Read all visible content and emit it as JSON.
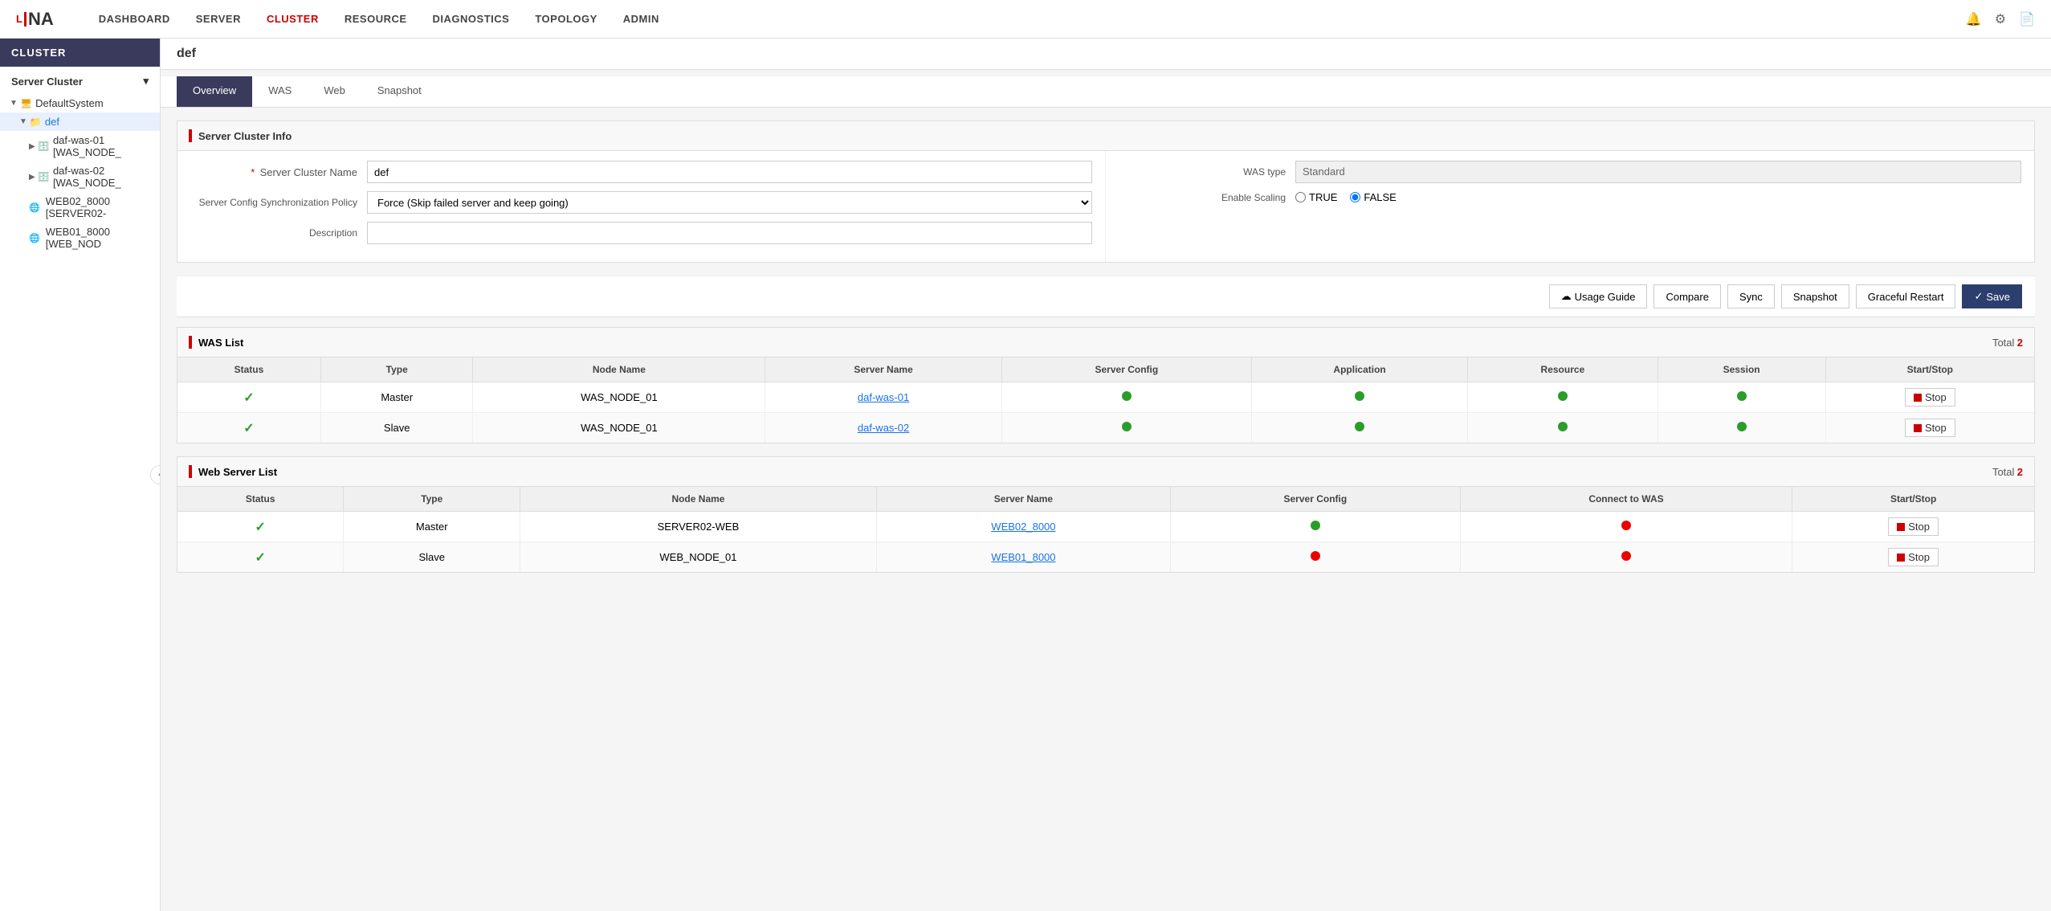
{
  "app": {
    "logo": "L—NA",
    "logo_text": "L—NA"
  },
  "nav": {
    "items": [
      {
        "id": "dashboard",
        "label": "DASHBOARD",
        "active": false
      },
      {
        "id": "server",
        "label": "SERVER",
        "active": false
      },
      {
        "id": "cluster",
        "label": "CLUSTER",
        "active": true
      },
      {
        "id": "resource",
        "label": "RESOURCE",
        "active": false
      },
      {
        "id": "diagnostics",
        "label": "DIAGNOSTICS",
        "active": false
      },
      {
        "id": "topology",
        "label": "TOPOLOGY",
        "active": false
      },
      {
        "id": "admin",
        "label": "ADMIN",
        "active": false
      }
    ]
  },
  "sidebar": {
    "header": "CLUSTER",
    "group_label": "Server Cluster",
    "tree": [
      {
        "id": "defaultsystem",
        "label": "DefaultSystem",
        "level": 1,
        "type": "system",
        "toggle": "▼"
      },
      {
        "id": "def",
        "label": "def",
        "level": 2,
        "type": "folder",
        "toggle": "▼",
        "selected": true
      },
      {
        "id": "daf-was-01",
        "label": "daf-was-01 [WAS_NODE_",
        "level": 3,
        "type": "server",
        "toggle": "▶"
      },
      {
        "id": "daf-was-02",
        "label": "daf-was-02 [WAS_NODE_",
        "level": 3,
        "type": "server",
        "toggle": "▶"
      },
      {
        "id": "web02_8000",
        "label": "WEB02_8000 [SERVER02-",
        "level": 3,
        "type": "web"
      },
      {
        "id": "web01_8000",
        "label": "WEB01_8000 [WEB_NOD",
        "level": 3,
        "type": "web"
      }
    ]
  },
  "page": {
    "title": "def"
  },
  "tabs": [
    {
      "id": "overview",
      "label": "Overview",
      "active": true
    },
    {
      "id": "was",
      "label": "WAS",
      "active": false
    },
    {
      "id": "web",
      "label": "Web",
      "active": false
    },
    {
      "id": "snapshot",
      "label": "Snapshot",
      "active": false
    }
  ],
  "server_cluster_info": {
    "title": "Server Cluster Info",
    "fields": {
      "cluster_name_label": "Server Cluster Name",
      "cluster_name_required": "*",
      "cluster_name_value": "def",
      "sync_policy_label": "Server Config Synchronization Policy",
      "sync_policy_value": "Force (Skip failed server and keep going)",
      "description_label": "Description",
      "description_value": "",
      "was_type_label": "WAS type",
      "was_type_value": "Standard",
      "enable_scaling_label": "Enable Scaling",
      "true_label": "TRUE",
      "false_label": "FALSE"
    }
  },
  "buttons": {
    "usage_guide": "Usage Guide",
    "compare": "Compare",
    "sync": "Sync",
    "snapshot": "Snapshot",
    "graceful_restart": "Graceful Restart",
    "save": "Save"
  },
  "was_list": {
    "title": "WAS List",
    "total_label": "Total",
    "total_count": "2",
    "columns": [
      "Status",
      "Type",
      "Node Name",
      "Server Name",
      "Server Config",
      "Application",
      "Resource",
      "Session",
      "Start/Stop"
    ],
    "rows": [
      {
        "status": "check",
        "type": "Master",
        "node_name": "WAS_NODE_01",
        "server_name": "daf-was-01",
        "server_config": "green",
        "application": "green",
        "resource": "green",
        "session": "green",
        "start_stop": "Stop"
      },
      {
        "status": "check",
        "type": "Slave",
        "node_name": "WAS_NODE_01",
        "server_name": "daf-was-02",
        "server_config": "green",
        "application": "green",
        "resource": "green",
        "session": "green",
        "start_stop": "Stop"
      }
    ]
  },
  "web_server_list": {
    "title": "Web Server List",
    "total_label": "Total",
    "total_count": "2",
    "columns": [
      "Status",
      "Type",
      "Node Name",
      "Server Name",
      "Server Config",
      "Connect to WAS",
      "Start/Stop"
    ],
    "rows": [
      {
        "status": "check",
        "type": "Master",
        "node_name": "SERVER02-WEB",
        "server_name": "WEB02_8000",
        "server_config": "green",
        "connect_to_was": "red",
        "start_stop": "Stop"
      },
      {
        "status": "check",
        "type": "Slave",
        "node_name": "WEB_NODE_01",
        "server_name": "WEB01_8000",
        "server_config": "red",
        "connect_to_was": "red",
        "start_stop": "Stop"
      }
    ]
  }
}
